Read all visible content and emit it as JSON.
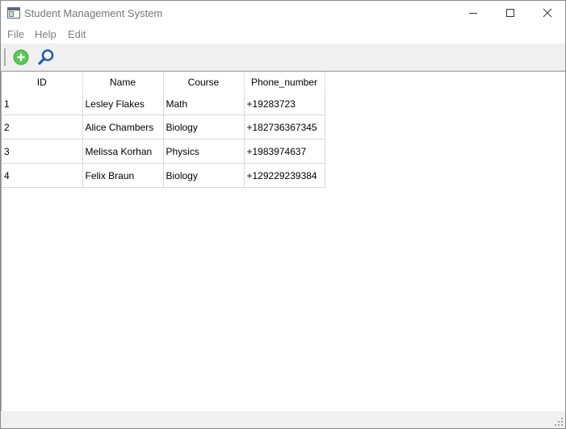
{
  "window": {
    "title": "Student Management System"
  },
  "menu": {
    "items": [
      {
        "label": "File"
      },
      {
        "label": "Help"
      },
      {
        "label": "Edit"
      }
    ]
  },
  "toolbar": {
    "buttons": [
      {
        "icon": "add-icon",
        "color": "#5cc85c"
      },
      {
        "icon": "search-icon",
        "color": "#1e5fb4"
      }
    ]
  },
  "table": {
    "columns": [
      "ID",
      "Name",
      "Course",
      "Phone_number"
    ],
    "rows": [
      [
        "1",
        "Lesley Flakes",
        "Math",
        "+19283723"
      ],
      [
        "2",
        "Alice Chambers",
        "Biology",
        "+182736367345"
      ],
      [
        "3",
        "Melissa Korhan",
        "Physics",
        "+1983974637"
      ],
      [
        "4",
        "Felix Braun",
        "Biology",
        "+129229239384"
      ]
    ]
  }
}
